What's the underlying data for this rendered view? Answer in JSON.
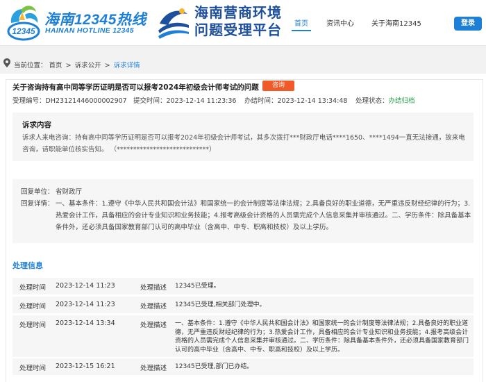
{
  "header": {
    "logo_cn": "海南12345热线",
    "logo_en": "HAINAN HOTLINE 12345",
    "platform_title_line1": "海南营商环境",
    "platform_title_line2": "问题受理平台",
    "nav": [
      "首页",
      "资讯中心",
      "关于海南12345"
    ],
    "login_label": "登录"
  },
  "breadcrumb": {
    "prefix": "当前位置：",
    "home": "首页",
    "separator": ">",
    "mid": "诉求公开",
    "current": "诉求详情"
  },
  "case": {
    "title": "关于咨询持有高中同等学历证明是否可以报考2024年初级会计师考试的问题",
    "tag": "咨询",
    "id_label": "受理编号：",
    "id_value": "DH23121446000002907",
    "submit_label": "提交时间：",
    "submit_value": "2023-12-14 11:23:36",
    "done_label": "办结时间：",
    "done_value": "2023-12-14 13:34:48",
    "status_label": "处理状态：",
    "status_value": "办结归档"
  },
  "appeal": {
    "heading": "诉求内容",
    "body": "诉求人来电咨询：持有高中同等学历证明是否可以报考2024年初级会计师考试，其多次拨打***财政厅电话****1650、****1494一直无法接通，故来电咨询，请职能单位核实告知。 （****************************）"
  },
  "reply": {
    "unit_label": "回复单位：",
    "unit_value": "省财政厅",
    "detail_label": "回复详情：",
    "detail_value": "一、基本条件：1.遵守《中华人民共和国会计法》和国家统一的会计制度等法律法规；2.具备良好的职业道德，无严重违反财经纪律的行为；3.热爱会计工作，具备相应的会计专业知识和业务技能；4.报考高级会计资格的人员需完成个人信息采集并审核通过。二、学历条件：除具备基本条件外，还必须具备国家教育部门认可的高中毕业（含高中、中专、职高和技校）及以上学历。"
  },
  "process": {
    "heading": "处理信息",
    "time_label": "处理时间",
    "desc_label": "处理描述",
    "rows": [
      {
        "time": "2023-12-14 11:23",
        "desc": "12345已受理。"
      },
      {
        "time": "2023-12-14 11:23",
        "desc": "12345已受理,相关部门处理中。"
      },
      {
        "time": "2023-12-14 13:34",
        "desc": "一、基本条件：1.遵守《中华人民共和国会计法》和国家统一的会计制度等法律法规；2.具备良好的职业道德，无严重违反财经纪律的行为；3.热爱会计工作，具备相应的会计专业知识和业务技能；4.报考高级会计资格的人员需完成个人信息采集并审核通过。二、学历条件：除具备基本条件外，还必须具备国家教育部门认可的高中毕业（含高中、中专、职高和技校）及以上学历。"
      },
      {
        "time": "2023-12-15 16:21",
        "desc": "12345已受理,部门已办结。"
      }
    ]
  },
  "colors": {
    "brand_blue": "#1e7fd6",
    "platform_navy": "#1d4f9c",
    "tag_orange": "#f05a28",
    "status_green": "#2aa54a",
    "panel_gray": "#f6f6f6"
  },
  "icons": [
    "location-pin-icon",
    "hotline-logo-icon",
    "platform-emblem-icon"
  ]
}
